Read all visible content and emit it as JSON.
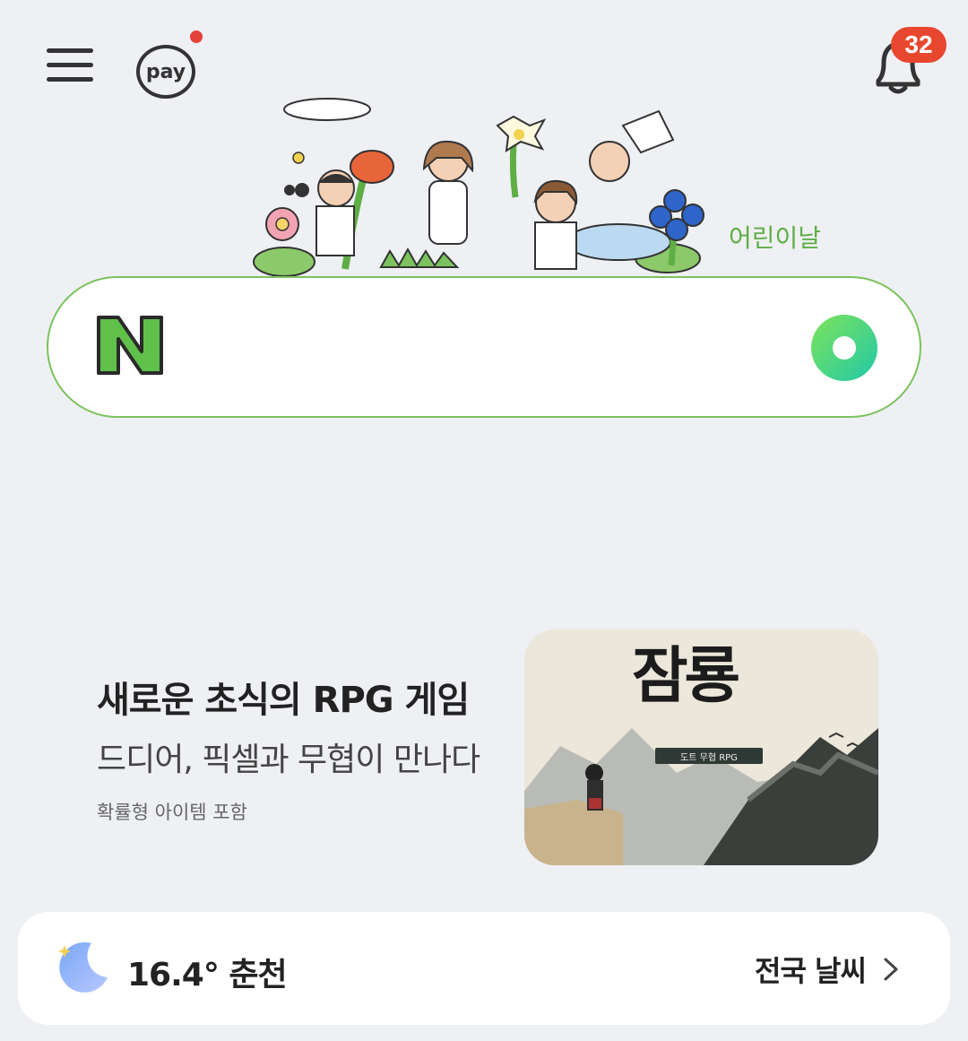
{
  "header": {
    "menu_icon": "hamburger-menu-icon",
    "pay_label": "pay",
    "notifications_count": "32"
  },
  "doodle": {
    "caption": "어린이날"
  },
  "search": {
    "logo_letter": "N",
    "accent_color": "#03c75a",
    "border_color": "#7cc25e"
  },
  "ad": {
    "headline": "새로운 초식의 RPG 게임",
    "subline": "드디어, 픽셀과 무협이 만나다",
    "note": "확률형 아이템 포함",
    "image_title": "잠룡",
    "image_tag": "도트 무협 RPG"
  },
  "weather": {
    "icon": "crescent-moon-icon",
    "temp_city": "16.4° 춘천",
    "link_label": "전국 날씨"
  }
}
